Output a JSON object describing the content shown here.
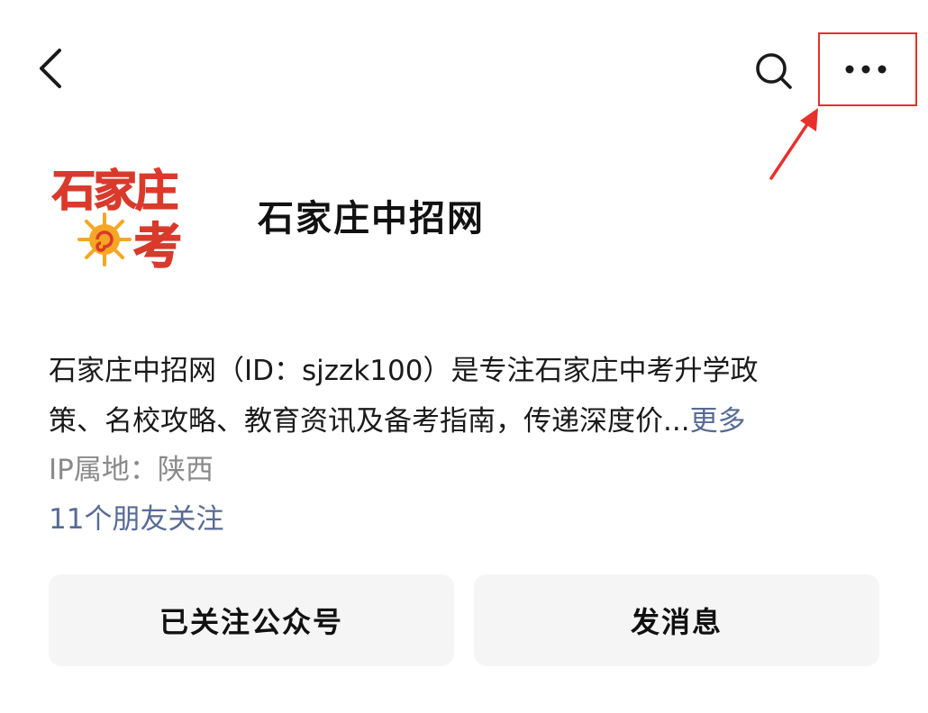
{
  "header": {
    "back_icon": "chevron-left-icon",
    "search_icon": "search-icon",
    "more_icon": "more-horizontal-icon",
    "highlight_color": "#e8302c"
  },
  "profile": {
    "avatar": {
      "line1": "石家庄",
      "line2": "考",
      "brand_red": "#d93a2b",
      "brand_orange": "#f5a623"
    },
    "name": "石家庄中招网",
    "bio_line1": "石家庄中招网（ID：sjzzk100）是专注石家庄中考升学政",
    "bio_line2": "策、名校攻略、教育资讯及备考指南，传递深度价...",
    "bio_more": "更多",
    "ip_location": "IP属地：陕西",
    "friends_follow": "11个朋友关注"
  },
  "actions": {
    "follow_label": "已关注公众号",
    "message_label": "发消息"
  },
  "colors": {
    "link": "#576b95",
    "secondary_text": "#8a8a8a",
    "button_bg": "#f5f5f5"
  }
}
